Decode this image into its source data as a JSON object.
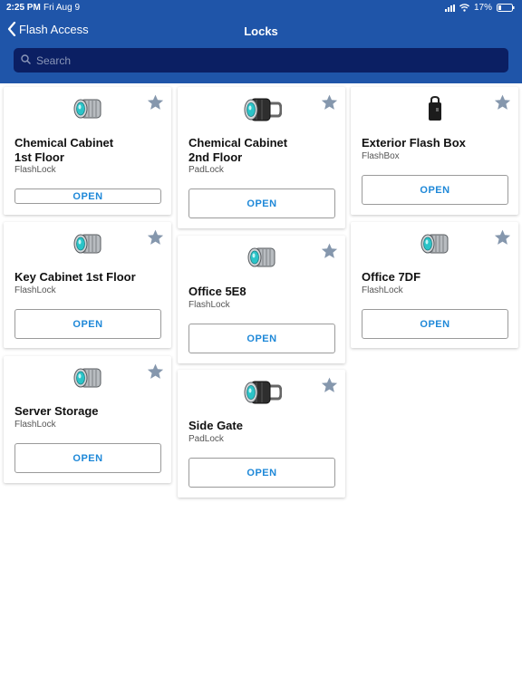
{
  "status_bar": {
    "time": "2:25 PM",
    "date": "Fri Aug 9",
    "battery": "17%"
  },
  "nav": {
    "back_label": "Flash Access",
    "title": "Locks"
  },
  "search": {
    "placeholder": "Search"
  },
  "open_label": "OPEN",
  "locks": [
    {
      "name": "Chemical Cabinet 1st Floor",
      "type": "FlashLock",
      "icon": "flashlock-cylinder-icon",
      "favorite_icon": "star-icon"
    },
    {
      "name": "Chemical Cabinet 2nd Floor",
      "type": "PadLock",
      "icon": "padlock-icon",
      "favorite_icon": "star-icon"
    },
    {
      "name": "Exterior Flash Box",
      "type": "FlashBox",
      "icon": "flashbox-icon",
      "favorite_icon": "star-icon"
    },
    {
      "name": "Key Cabinet 1st Floor",
      "type": "FlashLock",
      "icon": "flashlock-cylinder-icon",
      "favorite_icon": "star-icon"
    },
    {
      "name": "Office 5E8",
      "type": "FlashLock",
      "icon": "flashlock-cylinder-icon",
      "favorite_icon": "star-icon"
    },
    {
      "name": "Office 7DF",
      "type": "FlashLock",
      "icon": "flashlock-cylinder-icon",
      "favorite_icon": "star-icon"
    },
    {
      "name": "Server Storage",
      "type": "FlashLock",
      "icon": "flashlock-cylinder-icon",
      "favorite_icon": "star-icon"
    },
    {
      "name": "Side Gate",
      "type": "PadLock",
      "icon": "padlock-icon",
      "favorite_icon": "star-icon"
    }
  ],
  "colors": {
    "header": "#1f55a9",
    "search_bg": "#0b1f63",
    "accent": "#1e88d8",
    "star": "#8597ad"
  }
}
